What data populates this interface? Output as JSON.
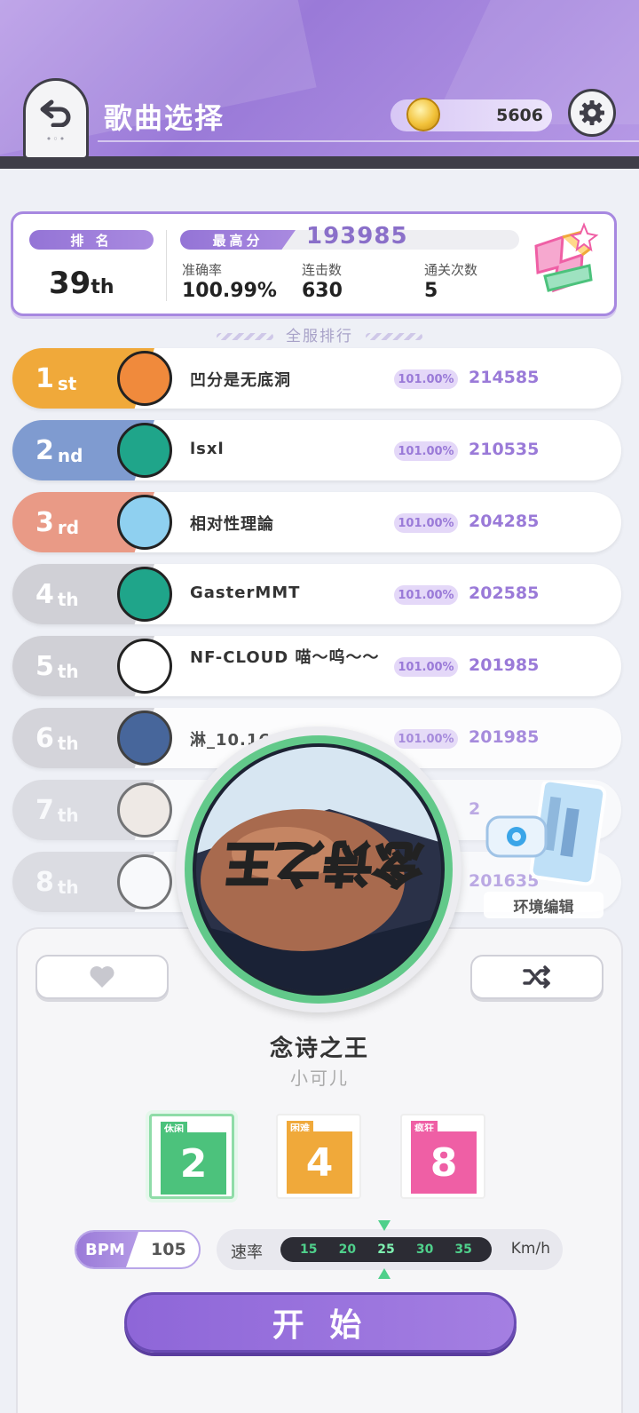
{
  "header": {
    "title": "歌曲选择",
    "coins": "5606"
  },
  "stats": {
    "rank_label": "排 名",
    "rank_value": "39",
    "rank_suffix": "th",
    "best_label": "最高分",
    "best_score": "193985",
    "accuracy_label": "准确率",
    "accuracy_value": "100.99%",
    "combo_label": "连击数",
    "combo_value": "630",
    "clears_label": "通关次数",
    "clears_value": "5"
  },
  "leaderboard": {
    "section_title": "全服排行",
    "rows": [
      {
        "rank": "1",
        "suffix": "st",
        "name": "凹分是无底洞",
        "acc": "101.00%",
        "score": "214585",
        "color": "#f0a93a"
      },
      {
        "rank": "2",
        "suffix": "nd",
        "name": "lsxl",
        "acc": "101.00%",
        "score": "210535",
        "color": "#7f9bd0"
      },
      {
        "rank": "3",
        "suffix": "rd",
        "name": "相对性理論",
        "acc": "101.00%",
        "score": "204285",
        "color": "#e99a86"
      },
      {
        "rank": "4",
        "suffix": "th",
        "name": "GasterMMT",
        "acc": "101.00%",
        "score": "202585",
        "color": "#d0d0d6"
      },
      {
        "rank": "5",
        "suffix": "th",
        "name": "NF-CLOUD 喵～呜～～",
        "acc": "101.00%",
        "score": "201985",
        "color": "#d0d0d6"
      },
      {
        "rank": "6",
        "suffix": "th",
        "name": "淋_10.16",
        "acc": "101.00%",
        "score": "201985",
        "color": "#d0d0d6"
      },
      {
        "rank": "7",
        "suffix": "th",
        "name": "",
        "acc": "",
        "score": "2",
        "color": "#d0d0d6"
      },
      {
        "rank": "8",
        "suffix": "th",
        "name": "",
        "acc": "",
        "score": "201635",
        "color": "#d0d0d6"
      }
    ]
  },
  "environment_edit_label": "环境编辑",
  "song": {
    "title": "念诗之王",
    "artist": "小可儿",
    "cover_text": "念诗之王"
  },
  "difficulties": [
    {
      "label": "休闲",
      "level": "2",
      "color": "#4cc27c"
    },
    {
      "label": "困难",
      "level": "4",
      "color": "#f0a93a"
    },
    {
      "label": "疯狂",
      "level": "8",
      "color": "#ef5fa5"
    }
  ],
  "bpm": {
    "label": "BPM",
    "value": "105"
  },
  "speed": {
    "label": "速率",
    "unit": "Km/h",
    "options": [
      "15",
      "20",
      "25",
      "30",
      "35"
    ],
    "selected": "25"
  },
  "start_label": "开 始"
}
